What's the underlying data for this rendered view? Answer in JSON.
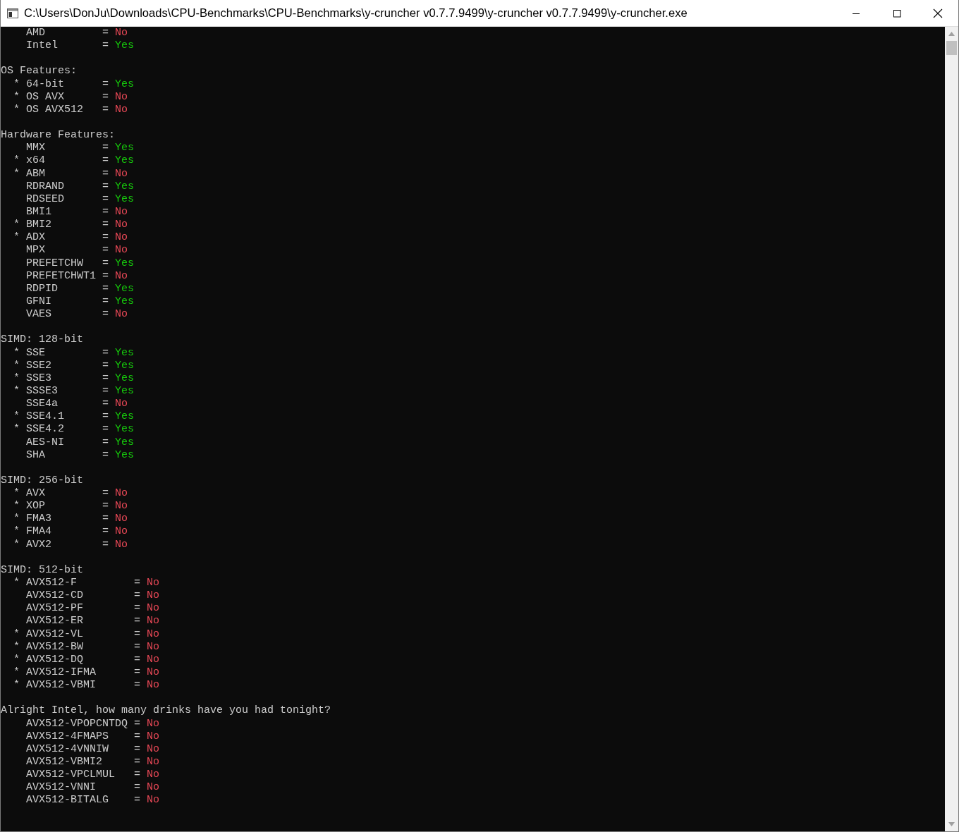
{
  "window": {
    "title": "C:\\Users\\DonJu\\Downloads\\CPU-Benchmarks\\CPU-Benchmarks\\y-cruncher v0.7.7.9499\\y-cruncher v0.7.7.9499\\y-cruncher.exe"
  },
  "console": {
    "sections": [
      {
        "kind": "narrow",
        "rows": [
          {
            "name": "AMD",
            "sep": "=",
            "value": "No",
            "supported": false
          },
          {
            "name": "Intel",
            "sep": "=",
            "value": "Yes",
            "supported": true
          }
        ]
      },
      {
        "kind": "narrow",
        "title": "OS Features:",
        "rows": [
          {
            "marker": "*",
            "name": "64-bit",
            "sep": "=",
            "value": "Yes",
            "supported": true
          },
          {
            "marker": "*",
            "name": "OS AVX",
            "sep": "=",
            "value": "No",
            "supported": false
          },
          {
            "marker": "*",
            "name": "OS AVX512",
            "sep": "=",
            "value": "No",
            "supported": false
          }
        ]
      },
      {
        "kind": "narrow",
        "title": "Hardware Features:",
        "rows": [
          {
            "name": "MMX",
            "sep": "=",
            "value": "Yes",
            "supported": true
          },
          {
            "marker": "*",
            "name": "x64",
            "sep": "=",
            "value": "Yes",
            "supported": true
          },
          {
            "marker": "*",
            "name": "ABM",
            "sep": "=",
            "value": "No",
            "supported": false
          },
          {
            "name": "RDRAND",
            "sep": "=",
            "value": "Yes",
            "supported": true
          },
          {
            "name": "RDSEED",
            "sep": "=",
            "value": "Yes",
            "supported": true
          },
          {
            "name": "BMI1",
            "sep": "=",
            "value": "No",
            "supported": false
          },
          {
            "marker": "*",
            "name": "BMI2",
            "sep": "=",
            "value": "No",
            "supported": false
          },
          {
            "marker": "*",
            "name": "ADX",
            "sep": "=",
            "value": "No",
            "supported": false
          },
          {
            "name": "MPX",
            "sep": "=",
            "value": "No",
            "supported": false
          },
          {
            "name": "PREFETCHW",
            "sep": "=",
            "value": "Yes",
            "supported": true
          },
          {
            "name": "PREFETCHWT1",
            "sep": "=",
            "value": "No",
            "supported": false
          },
          {
            "name": "RDPID",
            "sep": "=",
            "value": "Yes",
            "supported": true
          },
          {
            "name": "GFNI",
            "sep": "=",
            "value": "Yes",
            "supported": true
          },
          {
            "name": "VAES",
            "sep": "=",
            "value": "No",
            "supported": false
          }
        ]
      },
      {
        "kind": "narrow",
        "title": "SIMD: 128-bit",
        "rows": [
          {
            "marker": "*",
            "name": "SSE",
            "sep": "=",
            "value": "Yes",
            "supported": true
          },
          {
            "marker": "*",
            "name": "SSE2",
            "sep": "=",
            "value": "Yes",
            "supported": true
          },
          {
            "marker": "*",
            "name": "SSE3",
            "sep": "=",
            "value": "Yes",
            "supported": true
          },
          {
            "marker": "*",
            "name": "SSSE3",
            "sep": "=",
            "value": "Yes",
            "supported": true
          },
          {
            "name": "SSE4a",
            "sep": "=",
            "value": "No",
            "supported": false
          },
          {
            "marker": "*",
            "name": "SSE4.1",
            "sep": "=",
            "value": "Yes",
            "supported": true
          },
          {
            "marker": "*",
            "name": "SSE4.2",
            "sep": "=",
            "value": "Yes",
            "supported": true
          },
          {
            "name": "AES-NI",
            "sep": "=",
            "value": "Yes",
            "supported": true
          },
          {
            "name": "SHA",
            "sep": "=",
            "value": "Yes",
            "supported": true
          }
        ]
      },
      {
        "kind": "narrow",
        "title": "SIMD: 256-bit",
        "rows": [
          {
            "marker": "*",
            "name": "AVX",
            "sep": "=",
            "value": "No",
            "supported": false
          },
          {
            "marker": "*",
            "name": "XOP",
            "sep": "=",
            "value": "No",
            "supported": false
          },
          {
            "marker": "*",
            "name": "FMA3",
            "sep": "=",
            "value": "No",
            "supported": false
          },
          {
            "marker": "*",
            "name": "FMA4",
            "sep": "=",
            "value": "No",
            "supported": false
          },
          {
            "marker": "*",
            "name": "AVX2",
            "sep": "=",
            "value": "No",
            "supported": false
          }
        ]
      },
      {
        "kind": "wide",
        "title": "SIMD: 512-bit",
        "rows": [
          {
            "marker": "*",
            "name": "AVX512-F",
            "sep": "=",
            "value": "No",
            "supported": false
          },
          {
            "name": "AVX512-CD",
            "sep": "=",
            "value": "No",
            "supported": false
          },
          {
            "name": "AVX512-PF",
            "sep": "=",
            "value": "No",
            "supported": false
          },
          {
            "name": "AVX512-ER",
            "sep": "=",
            "value": "No",
            "supported": false
          },
          {
            "marker": "*",
            "name": "AVX512-VL",
            "sep": "=",
            "value": "No",
            "supported": false
          },
          {
            "marker": "*",
            "name": "AVX512-BW",
            "sep": "=",
            "value": "No",
            "supported": false
          },
          {
            "marker": "*",
            "name": "AVX512-DQ",
            "sep": "=",
            "value": "No",
            "supported": false
          },
          {
            "marker": "*",
            "name": "AVX512-IFMA",
            "sep": "=",
            "value": "No",
            "supported": false
          },
          {
            "marker": "*",
            "name": "AVX512-VBMI",
            "sep": "=",
            "value": "No",
            "supported": false
          }
        ]
      },
      {
        "kind": "wide",
        "title": "Alright Intel, how many drinks have you had tonight?",
        "rows": [
          {
            "name": "AVX512-VPOPCNTDQ",
            "sep": "=",
            "value": "No",
            "supported": false
          },
          {
            "name": "AVX512-4FMAPS",
            "sep": "=",
            "value": "No",
            "supported": false
          },
          {
            "name": "AVX512-4VNNIW",
            "sep": "=",
            "value": "No",
            "supported": false
          },
          {
            "name": "AVX512-VBMI2",
            "sep": "=",
            "value": "No",
            "supported": false
          },
          {
            "name": "AVX512-VPCLMUL",
            "sep": "=",
            "value": "No",
            "supported": false
          },
          {
            "name": "AVX512-VNNI",
            "sep": "=",
            "value": "No",
            "supported": false
          },
          {
            "name": "AVX512-BITALG",
            "sep": "=",
            "value": "No",
            "supported": false
          }
        ]
      }
    ]
  }
}
